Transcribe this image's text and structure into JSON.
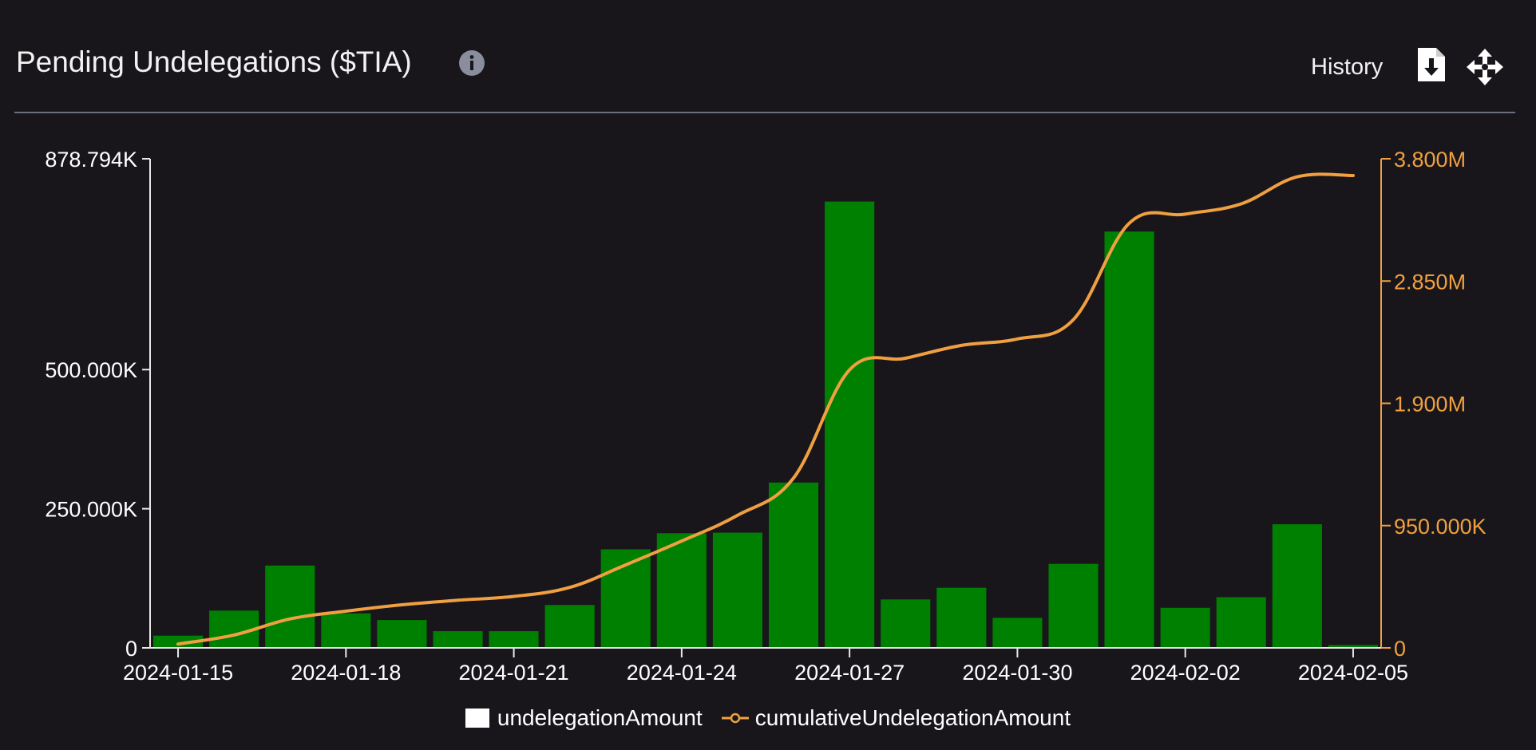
{
  "header": {
    "title": "Pending Undelegations ($TIA)",
    "history_label": "History",
    "icons": {
      "info": "info-icon",
      "download": "download-file-icon",
      "move": "move-arrows-icon"
    }
  },
  "colors": {
    "background": "#18161b",
    "bar": "#008000",
    "line": "#f0a040",
    "left_axis": "#ffffff",
    "right_axis": "#f0a040"
  },
  "chart_data": {
    "type": "bar",
    "categories": [
      "2024-01-15",
      "2024-01-16",
      "2024-01-17",
      "2024-01-18",
      "2024-01-19",
      "2024-01-20",
      "2024-01-21",
      "2024-01-22",
      "2024-01-23",
      "2024-01-24",
      "2024-01-25",
      "2024-01-26",
      "2024-01-27",
      "2024-01-28",
      "2024-01-29",
      "2024-01-30",
      "2024-01-31",
      "2024-02-01",
      "2024-02-02",
      "2024-02-03",
      "2024-02-04",
      "2024-02-05"
    ],
    "x_tick_labels": [
      "2024-01-15",
      "2024-01-18",
      "2024-01-21",
      "2024-01-24",
      "2024-01-27",
      "2024-01-30",
      "2024-02-02",
      "2024-02-05"
    ],
    "series": [
      {
        "name": "undelegationAmount",
        "type": "bar",
        "axis": "left",
        "values": [
          22000,
          67000,
          148000,
          62000,
          50000,
          30000,
          30000,
          77000,
          177000,
          206000,
          207000,
          297000,
          802000,
          87000,
          108000,
          54000,
          151000,
          748000,
          72000,
          91000,
          222000,
          5000
        ]
      },
      {
        "name": "cumulativeUndelegationAmount",
        "type": "line",
        "axis": "right",
        "values": [
          30000,
          100000,
          225000,
          285000,
          335000,
          370000,
          400000,
          470000,
          645000,
          830000,
          1030000,
          1320000,
          2160000,
          2250000,
          2350000,
          2400000,
          2550000,
          3300000,
          3370000,
          3450000,
          3660000,
          3670000
        ]
      }
    ],
    "y_left": {
      "range": [
        0,
        878794
      ],
      "tick_labels": [
        "0",
        "250.000K",
        "500.000K",
        "878.794K"
      ],
      "tick_values": [
        0,
        250000,
        500000,
        878794
      ]
    },
    "y_right": {
      "range": [
        0,
        3800000
      ],
      "tick_labels": [
        "0",
        "950.000K",
        "1.900M",
        "2.850M",
        "3.800M"
      ],
      "tick_values": [
        0,
        950000,
        1900000,
        2850000,
        3800000
      ]
    },
    "grid": false,
    "legend_position": "bottom-center"
  }
}
